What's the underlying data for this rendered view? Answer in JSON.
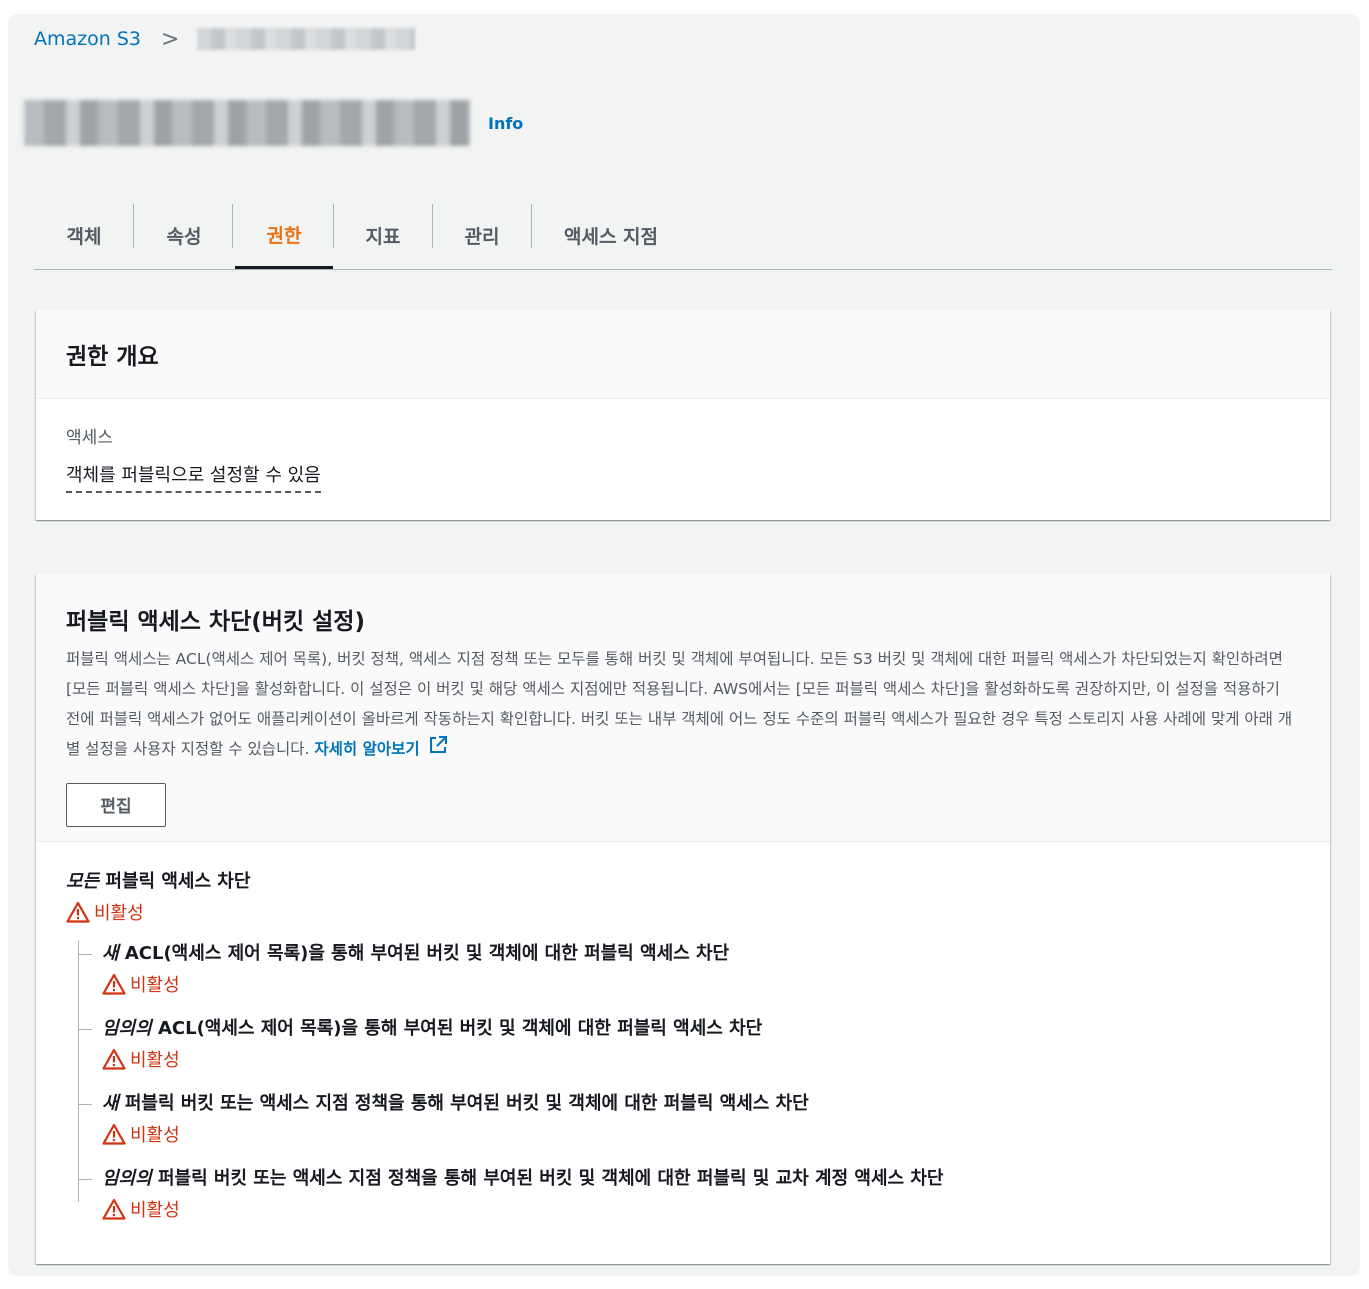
{
  "breadcrumb": {
    "root": "Amazon S3",
    "separator": ">"
  },
  "header": {
    "info_link": "Info"
  },
  "tabs": [
    "객체",
    "속성",
    "권한",
    "지표",
    "관리",
    "액세스 지점"
  ],
  "overview": {
    "title": "권한 개요",
    "access_label": "액세스",
    "access_value": "객체를 퍼블릭으로 설정할 수 있음"
  },
  "block_public_access": {
    "title": "퍼블릭 액세스 차단(버킷 설정)",
    "description": "퍼블릭 액세스는 ACL(액세스 제어 목록), 버킷 정책, 액세스 지점 정책 또는 모두를 통해 버킷 및 객체에 부여됩니다. 모든 S3 버킷 및 객체에 대한 퍼블릭 액세스가 차단되었는지 확인하려면 [모든 퍼블릭 액세스 차단]을 활성화합니다. 이 설정은 이 버킷 및 해당 액세스 지점에만 적용됩니다. AWS에서는 [모든 퍼블릭 액세스 차단]을 활성화하도록 권장하지만, 이 설정을 적용하기 전에 퍼블릭 액세스가 없어도 애플리케이션이 올바르게 작동하는지 확인합니다. 버킷 또는 내부 객체에 어느 정도 수준의 퍼블릭 액세스가 필요한 경우 특정 스토리지 사용 사례에 맞게 아래 개별 설정을 사용자 지정할 수 있습니다.",
    "learn_more": "자세히 알아보기",
    "edit_button": "편집",
    "main_setting": {
      "emphasis": "모든",
      "label": "퍼블릭 액세스 차단",
      "status": "비활성"
    },
    "sub_settings": [
      {
        "emphasis": "새",
        "label": "ACL(액세스 제어 목록)을 통해 부여된 버킷 및 객체에 대한 퍼블릭 액세스 차단",
        "status": "비활성"
      },
      {
        "emphasis": "임의의",
        "label": "ACL(액세스 제어 목록)을 통해 부여된 버킷 및 객체에 대한 퍼블릭 액세스 차단",
        "status": "비활성"
      },
      {
        "emphasis": "새",
        "label": "퍼블릭 버킷 또는 액세스 지점 정책을 통해 부여된 버킷 및 객체에 대한 퍼블릭 액세스 차단",
        "status": "비활성"
      },
      {
        "emphasis": "임의의",
        "label": "퍼블릭 버킷 또는 액세스 지점 정책을 통해 부여된 버킷 및 객체에 대한 퍼블릭 및 교차 계정 액세스 차단",
        "status": "비활성"
      }
    ]
  },
  "colors": {
    "link": "#0073bb",
    "active_tab": "#ec7211",
    "warning": "#d13212"
  }
}
